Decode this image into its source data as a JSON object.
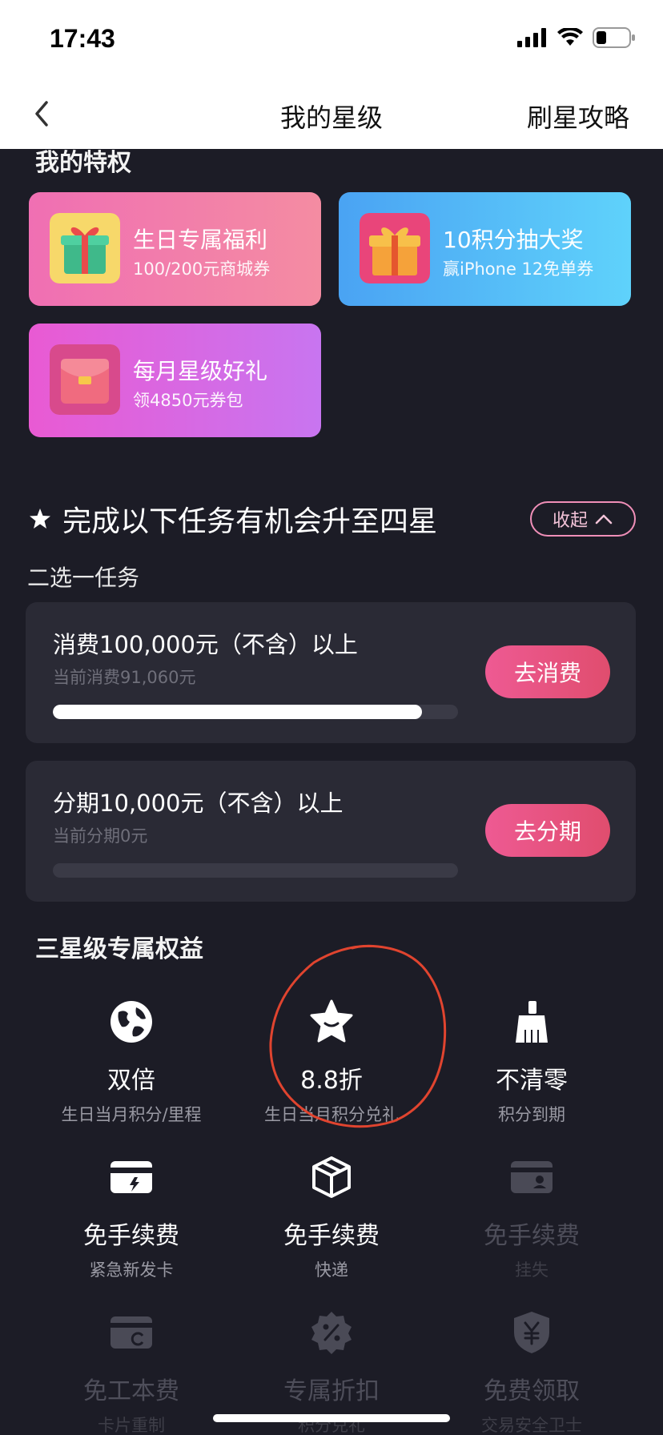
{
  "status_bar": {
    "time": "17:43"
  },
  "nav": {
    "title": "我的星级",
    "right_link": "刷星攻略"
  },
  "privileges": {
    "title": "我的特权",
    "cards": [
      {
        "title": "生日专属福利",
        "subtitle": "100/200元商城券"
      },
      {
        "title": "10积分抽大奖",
        "subtitle": "赢iPhone 12免单券"
      },
      {
        "title": "每月星级好礼",
        "subtitle": "领4850元券包"
      }
    ]
  },
  "tasks": {
    "heading": "完成以下任务有机会升至四星",
    "collapse_label": "收起",
    "group_label": "二选一任务",
    "items": [
      {
        "condition": "消费100,000元（不含）以上",
        "current": "当前消费91,060元",
        "progress": 0.9106,
        "button": "去消费"
      },
      {
        "condition": "分期10,000元（不含）以上",
        "current": "当前分期0元",
        "progress": 0,
        "button": "去分期"
      }
    ]
  },
  "benefits": {
    "title": "三星级专属权益",
    "items": [
      {
        "icon": "globe-icon",
        "name": "双倍",
        "desc": "生日当月积分/里程"
      },
      {
        "icon": "star-badge-icon",
        "name": "8.8折",
        "desc": "生日当月积分兑礼"
      },
      {
        "icon": "broom-icon",
        "name": "不清零",
        "desc": "积分到期"
      },
      {
        "icon": "card-flash-icon",
        "name": "免手续费",
        "desc": "紧急新发卡"
      },
      {
        "icon": "package-icon",
        "name": "免手续费",
        "desc": "快递"
      },
      {
        "icon": "card-user-icon",
        "name": "免手续费",
        "desc": "挂失"
      },
      {
        "icon": "card-refresh-icon",
        "name": "免工本费",
        "desc": "卡片重制"
      },
      {
        "icon": "discount-icon",
        "name": "专属折扣",
        "desc": "积分兑礼"
      },
      {
        "icon": "shield-yen-icon",
        "name": "免费领取",
        "desc": "交易安全卫士"
      }
    ]
  },
  "colors": {
    "accent": "#e8578a",
    "background": "#1c1c26",
    "card": "#2a2a35"
  }
}
